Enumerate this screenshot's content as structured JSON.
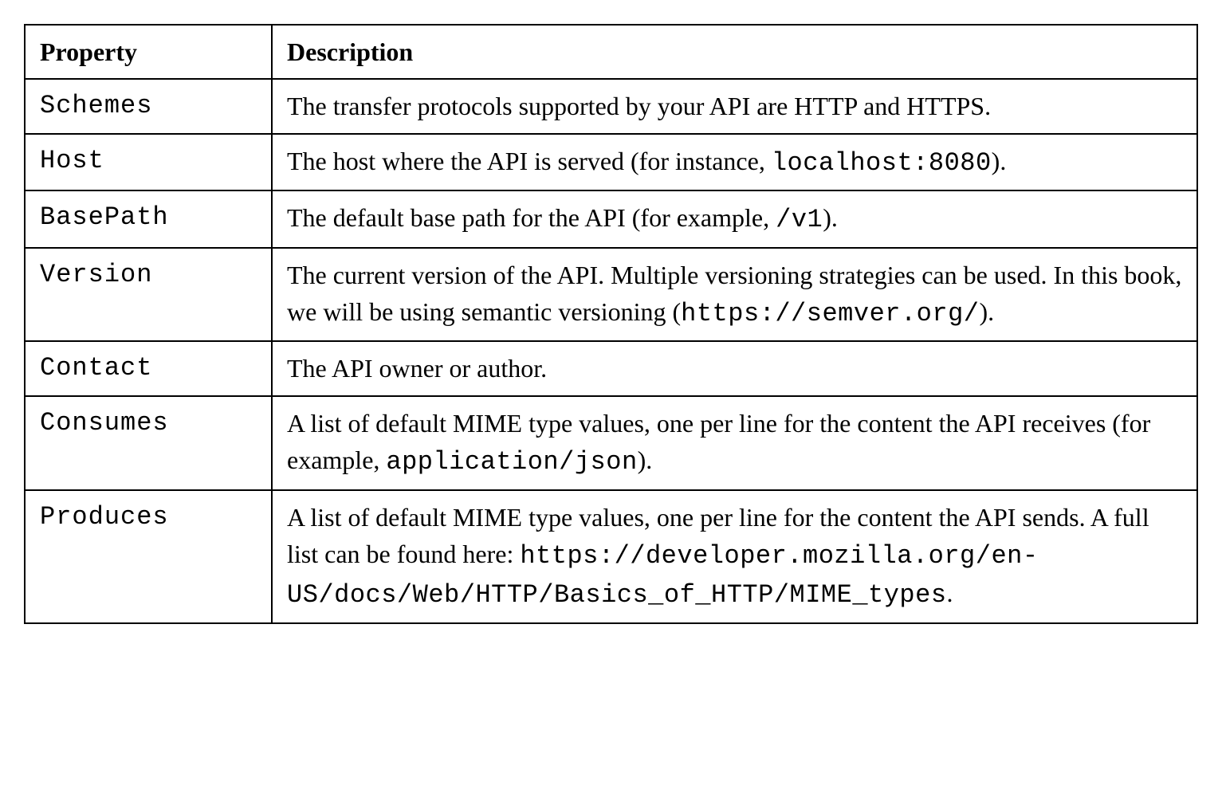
{
  "table": {
    "headers": {
      "property": "Property",
      "description": "Description"
    },
    "rows": [
      {
        "property": "Schemes",
        "description": [
          {
            "t": "text",
            "v": "The transfer protocols supported by your API are HTTP and HTTPS."
          }
        ]
      },
      {
        "property": "Host",
        "description": [
          {
            "t": "text",
            "v": "The host where the API is served (for instance, "
          },
          {
            "t": "mono",
            "v": "localhost:8080"
          },
          {
            "t": "text",
            "v": ")."
          }
        ]
      },
      {
        "property": "BasePath",
        "description": [
          {
            "t": "text",
            "v": "The default base path for the API (for example, "
          },
          {
            "t": "mono",
            "v": "/v1"
          },
          {
            "t": "text",
            "v": ")."
          }
        ]
      },
      {
        "property": "Version",
        "description": [
          {
            "t": "text",
            "v": "The current version of the API. Multiple versioning strategies can be used. In this book, we will be using semantic versioning ("
          },
          {
            "t": "mono",
            "v": "https://semver.org/"
          },
          {
            "t": "text",
            "v": ")."
          }
        ]
      },
      {
        "property": "Contact",
        "description": [
          {
            "t": "text",
            "v": "The API owner or author."
          }
        ]
      },
      {
        "property": "Consumes",
        "description": [
          {
            "t": "text",
            "v": "A list of default MIME type values, one per line for the content the API receives (for example, "
          },
          {
            "t": "mono",
            "v": "application/json"
          },
          {
            "t": "text",
            "v": ")."
          }
        ]
      },
      {
        "property": "Produces",
        "description": [
          {
            "t": "text",
            "v": "A list of default MIME type values, one per line for the content the API sends. A full list can be found here: "
          },
          {
            "t": "mono",
            "v": "https://developer.mozilla.org/en-US/docs/Web/HTTP/Basics_of_HTTP/MIME_types"
          },
          {
            "t": "text",
            "v": "."
          }
        ]
      }
    ]
  }
}
